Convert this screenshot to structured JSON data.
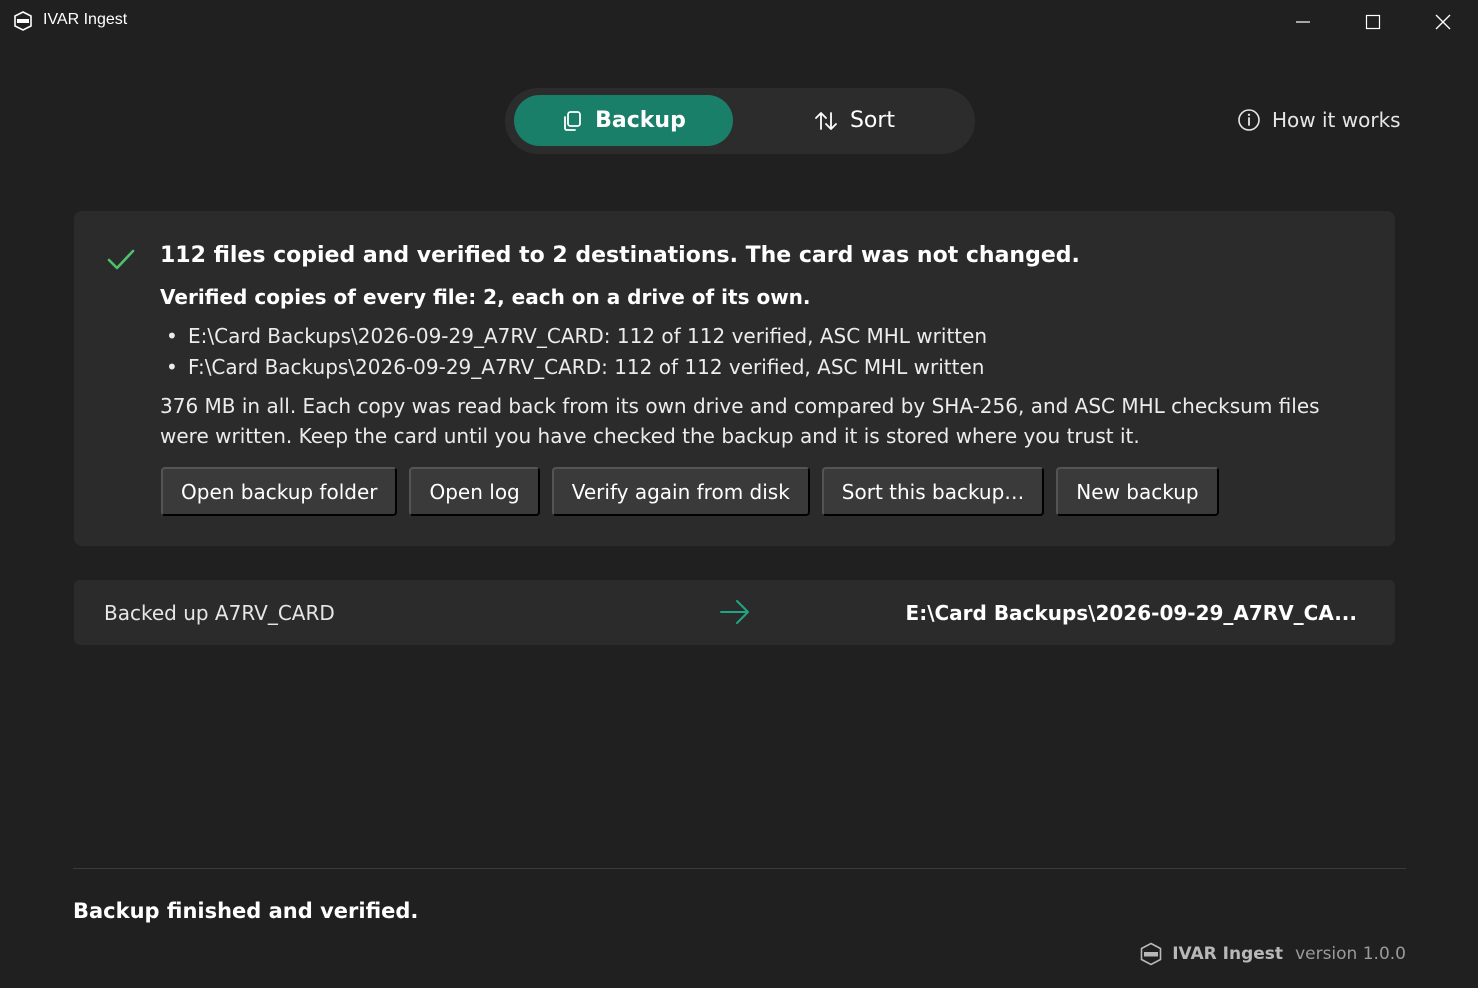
{
  "window": {
    "title": "IVAR Ingest",
    "logo_icon": "ivar-badge-icon",
    "controls": [
      "minimize-icon",
      "maximize-icon",
      "close-icon"
    ]
  },
  "mode_switch": {
    "backup_label": "Backup",
    "backup_icon": "copy-icon",
    "sort_label": "Sort",
    "sort_icon": "sort-arrows-icon",
    "active": "Backup",
    "accent_color": "#1a7f69"
  },
  "help": {
    "label": "How it works",
    "icon": "info-icon"
  },
  "result": {
    "status_icon": "check-icon",
    "status_color": "#4cc26a",
    "headline": "112 files copied and verified to 2 destinations. The card was not changed.",
    "verified_summary": "Verified copies of every file: 2, each on a drive of its own.",
    "destinations": [
      "E:\\Card Backups\\2026-09-29_A7RV_CARD: 112 of 112 verified, ASC MHL written",
      "F:\\Card Backups\\2026-09-29_A7RV_CARD: 112 of 112 verified, ASC MHL written"
    ],
    "details": "376 MB in all. Each copy was read back from its own drive and compared by SHA-256, and ASC MHL checksum files were written. Keep the card until you have checked the backup and it is stored where you trust it.",
    "actions": [
      "Open backup folder",
      "Open log",
      "Verify again from disk",
      "Sort this backup…",
      "New backup"
    ]
  },
  "transfer": {
    "source": "Backed up A7RV_CARD",
    "arrow_icon": "arrow-right-icon",
    "destination": "E:\\Card Backups\\2026-09-29_A7RV_CA..."
  },
  "footer": {
    "status": "Backup finished and verified.",
    "app_name": "IVAR Ingest",
    "version": "version 1.0.0"
  }
}
